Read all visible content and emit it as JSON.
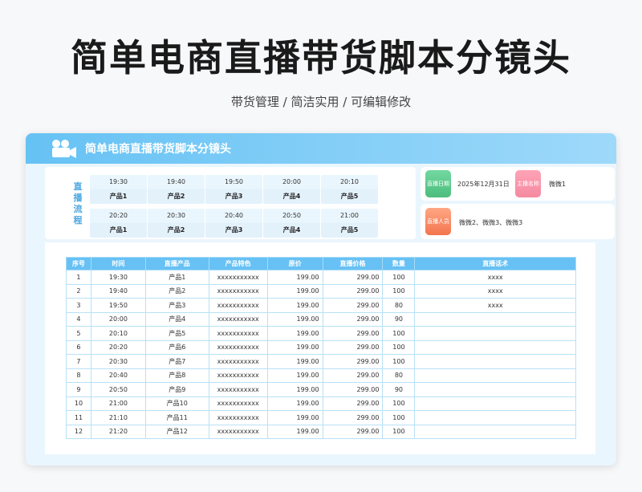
{
  "title": "简单电商直播带货脚本分镜头",
  "subtitle": "带货管理 / 简洁实用 /  可编辑修改",
  "card": {
    "header_title": "简单电商直播带货脚本分镜头",
    "flow_label": "直播流程",
    "flow_row1": [
      {
        "time": "19:30",
        "product": "产品1"
      },
      {
        "time": "19:40",
        "product": "产品2"
      },
      {
        "time": "19:50",
        "product": "产品3"
      },
      {
        "time": "20:00",
        "product": "产品4"
      },
      {
        "time": "20:10",
        "product": "产品5"
      }
    ],
    "flow_row2": [
      {
        "time": "20:20",
        "product": "产品1"
      },
      {
        "time": "20:30",
        "product": "产品2"
      },
      {
        "time": "20:40",
        "product": "产品3"
      },
      {
        "time": "20:50",
        "product": "产品4"
      },
      {
        "time": "21:00",
        "product": "产品5"
      }
    ],
    "info": {
      "date_badge": "直播日期",
      "date_value": "2025年12月31日",
      "host_badge": "主播名称",
      "host_value": "微微1",
      "staff_badge": "直播人员",
      "staff_value": "微微2、微微3、微微3"
    }
  },
  "table": {
    "headers": [
      "序号",
      "时间",
      "直播产品",
      "产品特色",
      "原价",
      "直播价格",
      "数量",
      "直播话术"
    ],
    "rows": [
      [
        "1",
        "19:30",
        "产品1",
        "xxxxxxxxxxx",
        "199.00",
        "299.00",
        "100",
        "xxxx"
      ],
      [
        "2",
        "19:40",
        "产品2",
        "xxxxxxxxxxx",
        "199.00",
        "299.00",
        "100",
        "xxxx"
      ],
      [
        "3",
        "19:50",
        "产品3",
        "xxxxxxxxxxx",
        "199.00",
        "299.00",
        "80",
        "xxxx"
      ],
      [
        "4",
        "20:00",
        "产品4",
        "xxxxxxxxxxx",
        "199.00",
        "299.00",
        "90",
        ""
      ],
      [
        "5",
        "20:10",
        "产品5",
        "xxxxxxxxxxx",
        "199.00",
        "299.00",
        "100",
        ""
      ],
      [
        "6",
        "20:20",
        "产品6",
        "xxxxxxxxxxx",
        "199.00",
        "299.00",
        "100",
        ""
      ],
      [
        "7",
        "20:30",
        "产品7",
        "xxxxxxxxxxx",
        "199.00",
        "299.00",
        "100",
        ""
      ],
      [
        "8",
        "20:40",
        "产品8",
        "xxxxxxxxxxx",
        "199.00",
        "299.00",
        "80",
        ""
      ],
      [
        "9",
        "20:50",
        "产品9",
        "xxxxxxxxxxx",
        "199.00",
        "299.00",
        "90",
        ""
      ],
      [
        "10",
        "21:00",
        "产品10",
        "xxxxxxxxxxx",
        "199.00",
        "299.00",
        "100",
        ""
      ],
      [
        "11",
        "21:10",
        "产品11",
        "xxxxxxxxxxx",
        "199.00",
        "299.00",
        "100",
        ""
      ],
      [
        "12",
        "21:20",
        "产品12",
        "xxxxxxxxxxx",
        "199.00",
        "299.00",
        "100",
        ""
      ]
    ]
  },
  "colors": {
    "header_blue": "#67c1f4",
    "badge_green": "#4dbd7e",
    "badge_pink": "#f48aa0",
    "badge_orange": "#f3754f"
  },
  "icons": {
    "header_icon": "video-camera-icon"
  }
}
